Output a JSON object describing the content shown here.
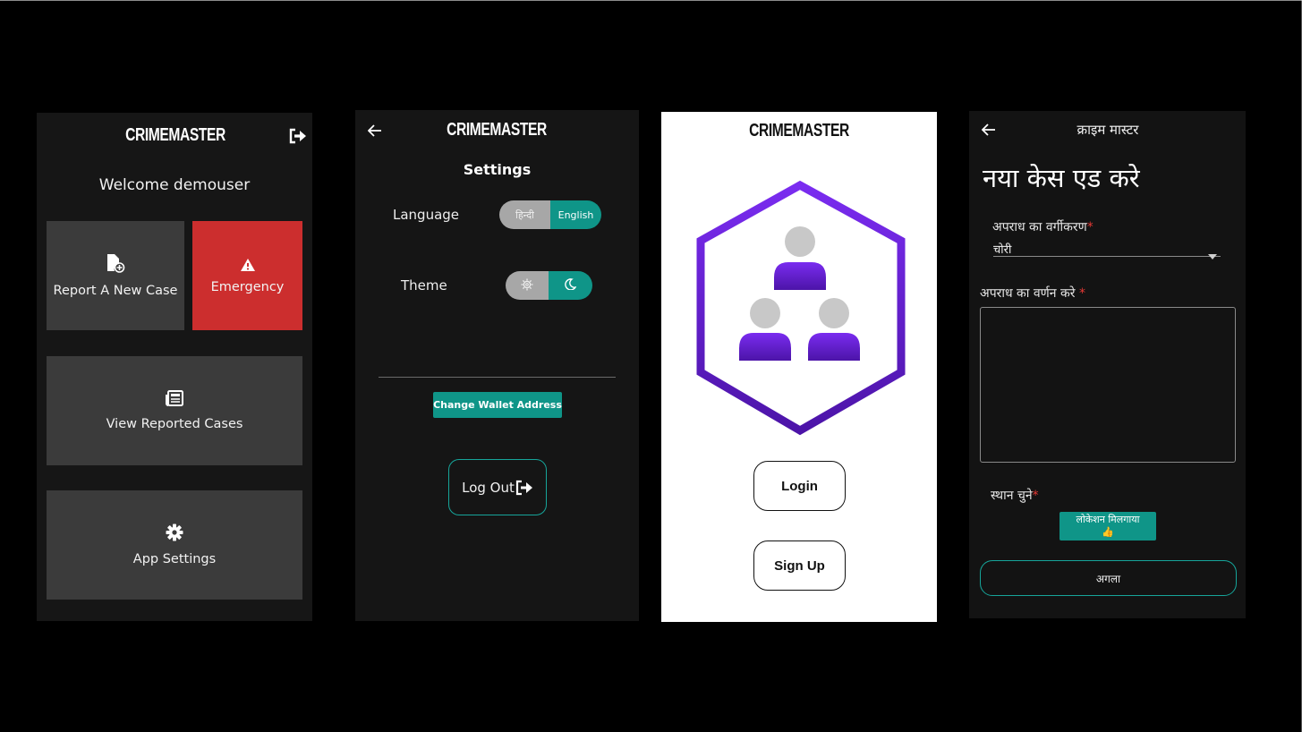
{
  "home": {
    "brand": "CRIMEMASTER",
    "welcome": "Welcome  demouser",
    "tiles": {
      "report": "Report A New Case",
      "emergency": "Emergency",
      "view": "View Reported Cases",
      "settings": "App Settings"
    }
  },
  "settings": {
    "brand": "CRIMEMASTER",
    "title": "Settings",
    "language_label": "Language",
    "language_options": [
      "हिन्दी",
      "English"
    ],
    "selected_language": "English",
    "theme_label": "Theme",
    "change_wallet": "Change Wallet Address",
    "logout": "Log Out"
  },
  "landing": {
    "brand": "CRIMEMASTER",
    "login": "Login",
    "signup": "Sign Up"
  },
  "add_case": {
    "brand": "क्राइम मास्टर",
    "title": "नया केस एड करे",
    "classification_label": "अपराध का वर्गीकरण",
    "classification_value": "चोरी",
    "description_label": "अपराध का वर्णन करे ",
    "location_label": "स्थान चुने",
    "location_button_line1": "लोकेशन मिलगाया",
    "location_button_emoji": "👍",
    "next": "अगला",
    "required_mark": "*"
  },
  "colors": {
    "teal": "#0f9588",
    "emergency_red": "#cc2e2e",
    "tile_gray": "#3b3b3b",
    "logo_purple": "#6a1fd1"
  }
}
